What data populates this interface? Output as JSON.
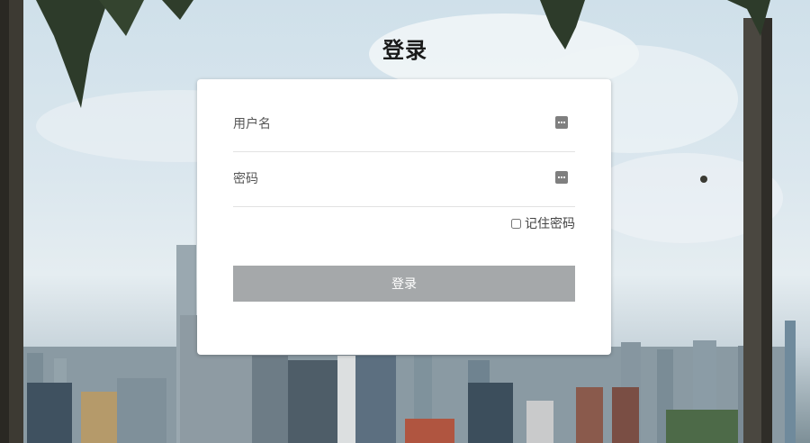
{
  "page": {
    "title": "登录",
    "background": "city-skyline-with-palm-trees"
  },
  "form": {
    "username_placeholder": "用户名",
    "password_placeholder": "密码",
    "username_value": "",
    "password_value": "",
    "username_icon": "keyboard-icon",
    "password_icon": "keyboard-icon",
    "remember_label": "记住密码",
    "remember_checked": false,
    "submit_label": "登录"
  },
  "colors": {
    "button_bg": "#a5a8aa",
    "card_bg": "#ffffff"
  }
}
